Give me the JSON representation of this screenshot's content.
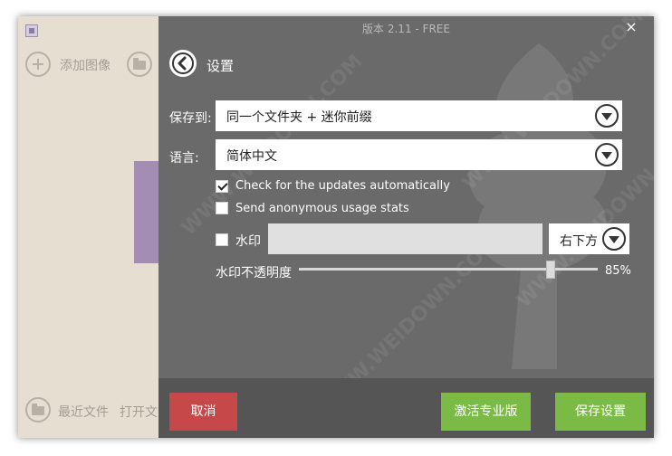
{
  "app": {
    "left_actions": {
      "add_image_label": "添加图像",
      "recent_files_label": "最近文件",
      "open_file_label": "打开文"
    }
  },
  "dialog": {
    "title": "版本 2.11 - FREE",
    "close_glyph": "×",
    "heading": "设置",
    "save_to": {
      "label": "保存到:",
      "value": "同一个文件夹 + 迷你前缀"
    },
    "language": {
      "label": "语言:",
      "value": "简体中文"
    },
    "check_updates": {
      "label": "Check for the updates automatically",
      "checked": true
    },
    "anonymous_stats": {
      "label": "Send anonymous usage stats",
      "checked": false
    },
    "watermark": {
      "label": "水印",
      "checked": false,
      "text_value": "",
      "position": "右下方"
    },
    "opacity": {
      "label": "水印不透明度",
      "value_text": "85%",
      "value": 0.85
    },
    "buttons": {
      "cancel": "取消",
      "activate_pro": "激活专业版",
      "save_settings": "保存设置"
    }
  },
  "colors": {
    "panel_bg": "#6a6a6a",
    "footer_bg": "#555555",
    "cancel": "#c74848",
    "accent_green": "#7bbb45",
    "app_bg": "#e6dfd1"
  }
}
